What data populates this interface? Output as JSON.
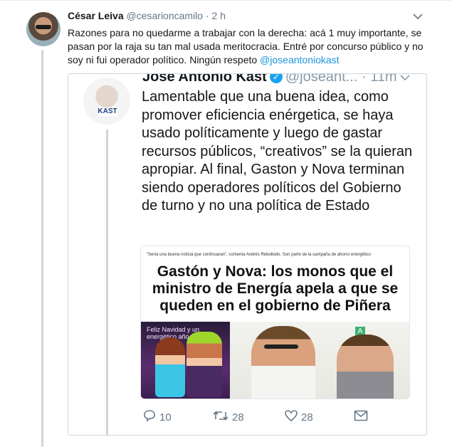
{
  "tweet": {
    "display_name": "César Leiva",
    "handle": "@cesarioncamilo",
    "separator": "·",
    "time": "2 h",
    "text_main": "Razones para no quedarme a trabajar con la derecha: acá 1 muy importante, se pasan por la raja su tan mal usada meritocracia. Entré por concurso público y no soy ni fui operador político. Ningún respeto ",
    "mention": "@joseantoniokast",
    "chevron_icon": "chevron-down-icon"
  },
  "quoted": {
    "display_name": "José Antonio Kast",
    "handle": "@joseant...",
    "separator": "·",
    "time": "11m",
    "avatar_logo": "KAST",
    "text": "Lamentable que una buena idea, como promover eficiencia enérgetica, se haya usado políticamente y luego de gastar recursos públicos, “creativos” se la quieran apropiar. Al final, Gaston y Nova terminan siendo operadores políticos del Gobierno de turno y no una política de Estado",
    "article": {
      "kicker": "“Sería una buena noticia que continuaran”, comenta Andrés Rebolledo. Son parte de la campaña de ahorro energético",
      "headline": "Gastón y Nova: los monos que el ministro de Energía apela a que se queden en el gobierno de Piñera",
      "cartoon_text": "Feliz Navidad y un energético año nuevo",
      "photo_sign": "A"
    },
    "actions": {
      "reply_count": "10",
      "retweet_count": "28",
      "like_count": "28"
    }
  },
  "colors": {
    "link": "#1b95e0",
    "verified": "#1da1f2",
    "muted": "#657786",
    "border": "#ccd6dd"
  }
}
